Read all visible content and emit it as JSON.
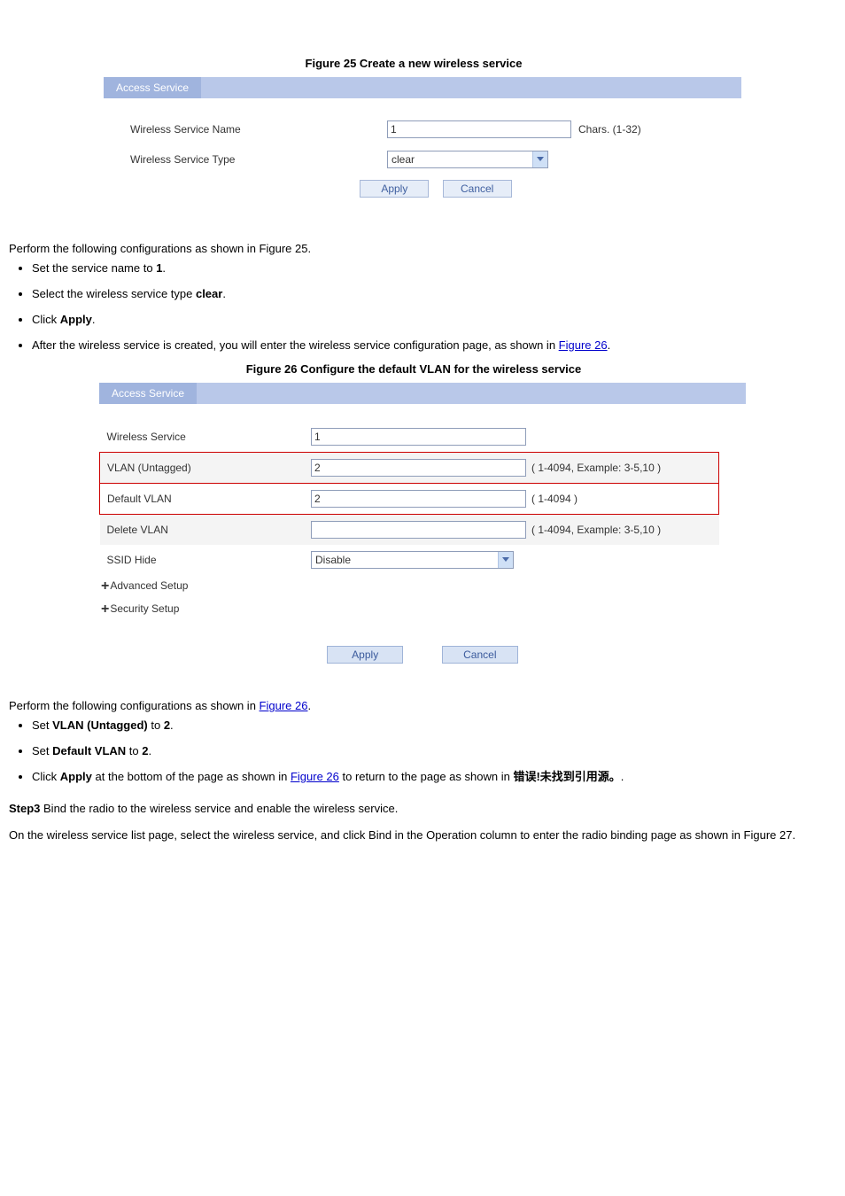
{
  "figure25": {
    "caption": "Figure 25 Create a new wireless service",
    "title": "Access Service",
    "name_label": "Wireless Service Name",
    "name_value": "1",
    "name_hint": "Chars. (1-32)",
    "type_label": "Wireless Service Type",
    "type_value": "clear",
    "apply": "Apply",
    "cancel": "Cancel"
  },
  "step2": {
    "intro": "Perform the following configurations as shown in Figure 25.",
    "items": [
      {
        "pre": "Set the service name to ",
        "bold": "1",
        "post": "."
      },
      {
        "pre": "Select the wireless service type ",
        "bold": "clear",
        "post": "."
      },
      {
        "pre": "Click ",
        "bold": "Apply",
        "post": "."
      }
    ],
    "last": "After the wireless service is created, you will enter the wireless service configuration page, as shown in ",
    "last_link": "Figure 26",
    "last_post": "."
  },
  "figure26": {
    "caption": "Figure 26 Configure the default VLAN for the wireless service",
    "title": "Access Service",
    "rows": {
      "ws_label": "Wireless Service",
      "ws_value": "1",
      "vlan_label": "VLAN (Untagged)",
      "vlan_value": "2",
      "vlan_help": "( 1-4094, Example: 3-5,10 )",
      "dvlan_label": "Default VLAN",
      "dvlan_value": "2",
      "dvlan_help": "( 1-4094 )",
      "del_label": "Delete VLAN",
      "del_value": "",
      "del_help": "( 1-4094, Example: 3-5,10 )",
      "ssid_label": "SSID Hide",
      "ssid_value": "Disable"
    },
    "adv": "Advanced Setup",
    "sec": "Security Setup",
    "apply": "Apply",
    "cancel": "Cancel"
  },
  "step26": {
    "intro_pre": "Perform the following configurations as shown in ",
    "intro_link": "Figure 26",
    "intro_post": ".",
    "items_a": {
      "pre": "Set ",
      "b1": "VLAN (Untagged)",
      "mid": " to ",
      "b2": "2",
      "post": "."
    },
    "items_b": {
      "pre": "Set ",
      "b1": "Default VLAN",
      "mid": " to ",
      "b2": "2",
      "post": "."
    },
    "items_c": {
      "pre": "Click ",
      "b1": "Apply",
      "mid1": " at the bottom of the page as shown in ",
      "link": "Figure 26",
      "mid2": " to return to the page as shown in ",
      "b2": "错误!未找到引用源。",
      "post": "."
    }
  },
  "step3": {
    "head_pre": "Step3 ",
    "head_rest": "Bind the radio to the wireless service and enable the wireless service.",
    "para": "On the wireless service list page, select the wireless service, and click Bind in the Operation column to enter the radio binding page as shown in Figure 27."
  }
}
